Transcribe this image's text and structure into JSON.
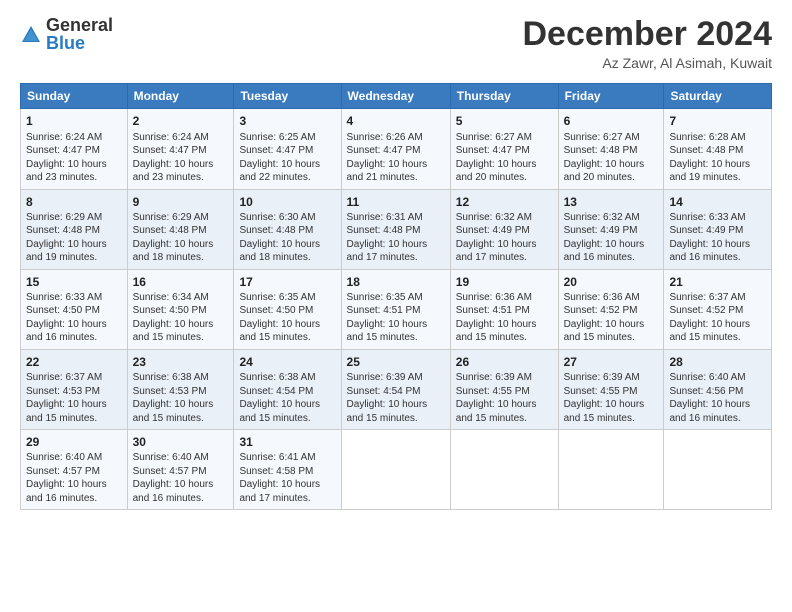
{
  "logo": {
    "general": "General",
    "blue": "Blue"
  },
  "header": {
    "month": "December 2024",
    "location": "Az Zawr, Al Asimah, Kuwait"
  },
  "days_of_week": [
    "Sunday",
    "Monday",
    "Tuesday",
    "Wednesday",
    "Thursday",
    "Friday",
    "Saturday"
  ],
  "weeks": [
    [
      {
        "day": "1",
        "data": "Sunrise: 6:24 AM\nSunset: 4:47 PM\nDaylight: 10 hours and 23 minutes."
      },
      {
        "day": "2",
        "data": "Sunrise: 6:24 AM\nSunset: 4:47 PM\nDaylight: 10 hours and 23 minutes."
      },
      {
        "day": "3",
        "data": "Sunrise: 6:25 AM\nSunset: 4:47 PM\nDaylight: 10 hours and 22 minutes."
      },
      {
        "day": "4",
        "data": "Sunrise: 6:26 AM\nSunset: 4:47 PM\nDaylight: 10 hours and 21 minutes."
      },
      {
        "day": "5",
        "data": "Sunrise: 6:27 AM\nSunset: 4:47 PM\nDaylight: 10 hours and 20 minutes."
      },
      {
        "day": "6",
        "data": "Sunrise: 6:27 AM\nSunset: 4:48 PM\nDaylight: 10 hours and 20 minutes."
      },
      {
        "day": "7",
        "data": "Sunrise: 6:28 AM\nSunset: 4:48 PM\nDaylight: 10 hours and 19 minutes."
      }
    ],
    [
      {
        "day": "8",
        "data": "Sunrise: 6:29 AM\nSunset: 4:48 PM\nDaylight: 10 hours and 19 minutes."
      },
      {
        "day": "9",
        "data": "Sunrise: 6:29 AM\nSunset: 4:48 PM\nDaylight: 10 hours and 18 minutes."
      },
      {
        "day": "10",
        "data": "Sunrise: 6:30 AM\nSunset: 4:48 PM\nDaylight: 10 hours and 18 minutes."
      },
      {
        "day": "11",
        "data": "Sunrise: 6:31 AM\nSunset: 4:48 PM\nDaylight: 10 hours and 17 minutes."
      },
      {
        "day": "12",
        "data": "Sunrise: 6:32 AM\nSunset: 4:49 PM\nDaylight: 10 hours and 17 minutes."
      },
      {
        "day": "13",
        "data": "Sunrise: 6:32 AM\nSunset: 4:49 PM\nDaylight: 10 hours and 16 minutes."
      },
      {
        "day": "14",
        "data": "Sunrise: 6:33 AM\nSunset: 4:49 PM\nDaylight: 10 hours and 16 minutes."
      }
    ],
    [
      {
        "day": "15",
        "data": "Sunrise: 6:33 AM\nSunset: 4:50 PM\nDaylight: 10 hours and 16 minutes."
      },
      {
        "day": "16",
        "data": "Sunrise: 6:34 AM\nSunset: 4:50 PM\nDaylight: 10 hours and 15 minutes."
      },
      {
        "day": "17",
        "data": "Sunrise: 6:35 AM\nSunset: 4:50 PM\nDaylight: 10 hours and 15 minutes."
      },
      {
        "day": "18",
        "data": "Sunrise: 6:35 AM\nSunset: 4:51 PM\nDaylight: 10 hours and 15 minutes."
      },
      {
        "day": "19",
        "data": "Sunrise: 6:36 AM\nSunset: 4:51 PM\nDaylight: 10 hours and 15 minutes."
      },
      {
        "day": "20",
        "data": "Sunrise: 6:36 AM\nSunset: 4:52 PM\nDaylight: 10 hours and 15 minutes."
      },
      {
        "day": "21",
        "data": "Sunrise: 6:37 AM\nSunset: 4:52 PM\nDaylight: 10 hours and 15 minutes."
      }
    ],
    [
      {
        "day": "22",
        "data": "Sunrise: 6:37 AM\nSunset: 4:53 PM\nDaylight: 10 hours and 15 minutes."
      },
      {
        "day": "23",
        "data": "Sunrise: 6:38 AM\nSunset: 4:53 PM\nDaylight: 10 hours and 15 minutes."
      },
      {
        "day": "24",
        "data": "Sunrise: 6:38 AM\nSunset: 4:54 PM\nDaylight: 10 hours and 15 minutes."
      },
      {
        "day": "25",
        "data": "Sunrise: 6:39 AM\nSunset: 4:54 PM\nDaylight: 10 hours and 15 minutes."
      },
      {
        "day": "26",
        "data": "Sunrise: 6:39 AM\nSunset: 4:55 PM\nDaylight: 10 hours and 15 minutes."
      },
      {
        "day": "27",
        "data": "Sunrise: 6:39 AM\nSunset: 4:55 PM\nDaylight: 10 hours and 15 minutes."
      },
      {
        "day": "28",
        "data": "Sunrise: 6:40 AM\nSunset: 4:56 PM\nDaylight: 10 hours and 16 minutes."
      }
    ],
    [
      {
        "day": "29",
        "data": "Sunrise: 6:40 AM\nSunset: 4:57 PM\nDaylight: 10 hours and 16 minutes."
      },
      {
        "day": "30",
        "data": "Sunrise: 6:40 AM\nSunset: 4:57 PM\nDaylight: 10 hours and 16 minutes."
      },
      {
        "day": "31",
        "data": "Sunrise: 6:41 AM\nSunset: 4:58 PM\nDaylight: 10 hours and 17 minutes."
      },
      null,
      null,
      null,
      null
    ]
  ]
}
